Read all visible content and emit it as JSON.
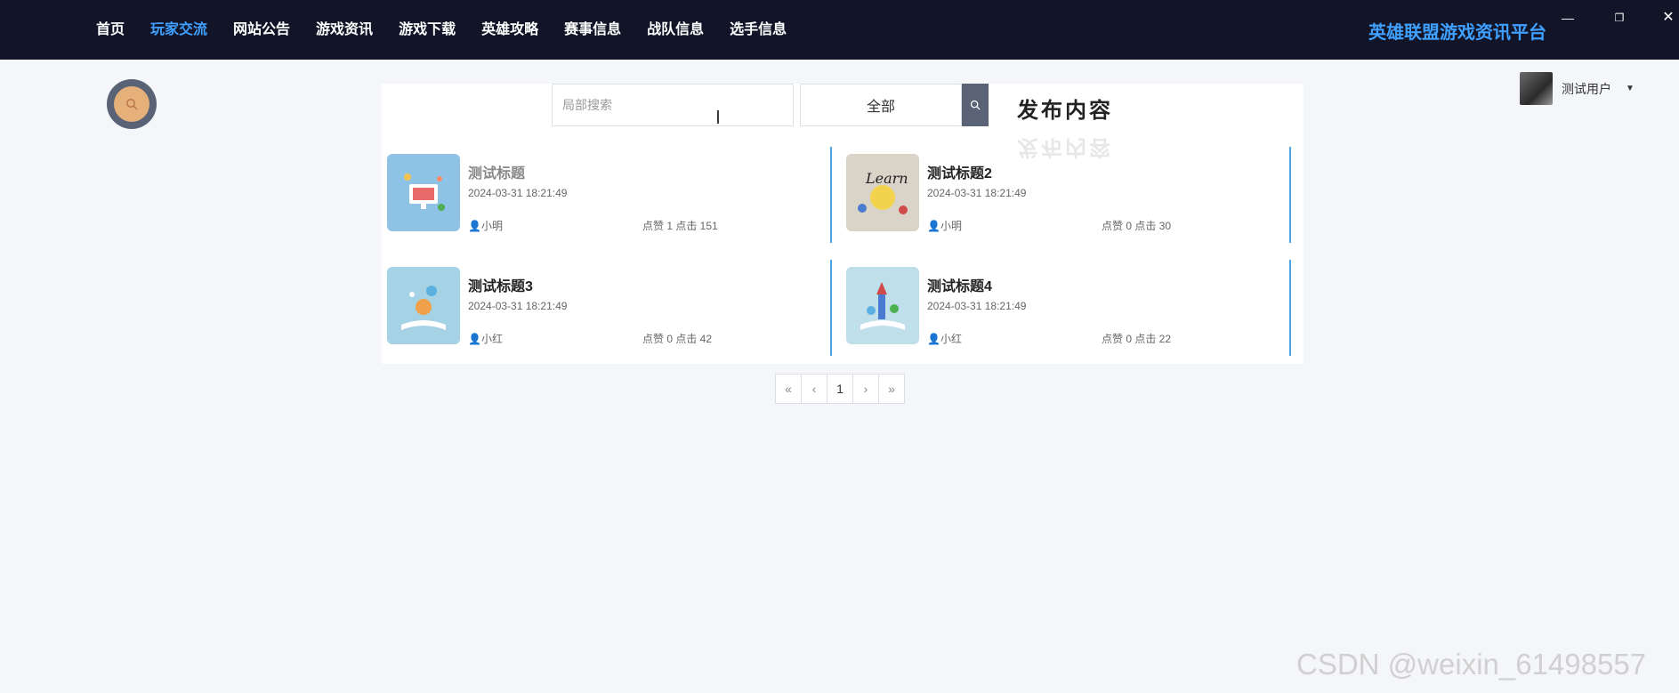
{
  "nav": [
    {
      "label": "首页",
      "active": false
    },
    {
      "label": "玩家交流",
      "active": true
    },
    {
      "label": "网站公告",
      "active": false
    },
    {
      "label": "游戏资讯",
      "active": false
    },
    {
      "label": "游戏下载",
      "active": false
    },
    {
      "label": "英雄攻略",
      "active": false
    },
    {
      "label": "赛事信息",
      "active": false
    },
    {
      "label": "战队信息",
      "active": false
    },
    {
      "label": "选手信息",
      "active": false
    }
  ],
  "brand": "英雄联盟游戏资讯平台",
  "window_controls": {
    "minimize": "—",
    "maximize": "❐",
    "close": "✕"
  },
  "user": {
    "name": "测试用户",
    "caret": "▼"
  },
  "search": {
    "placeholder": "局部搜索",
    "category": "全部",
    "button_icon": "search-icon"
  },
  "publish_label": "发布内容",
  "posts": [
    {
      "title": "测试标题",
      "date": "2024-03-31 18:21:49",
      "author": "小明",
      "stats": "点赞 1 点击 151",
      "thumb_color": "#8fc3e6"
    },
    {
      "title": "测试标题2",
      "date": "2024-03-31 18:21:49",
      "author": "小明",
      "stats": "点赞 0 点击 30",
      "thumb_color": "#d9d4c7"
    },
    {
      "title": "测试标题3",
      "date": "2024-03-31 18:21:49",
      "author": "小红",
      "stats": "点赞 0 点击 42",
      "thumb_color": "#a6d2e6"
    },
    {
      "title": "测试标题4",
      "date": "2024-03-31 18:21:49",
      "author": "小红",
      "stats": "点赞 0 点击 22",
      "thumb_color": "#bfe0ea"
    }
  ],
  "pagination": {
    "first": "«",
    "prev": "‹",
    "current": "1",
    "next": "›",
    "last": "»"
  },
  "watermark": "CSDN @weixin_61498557"
}
